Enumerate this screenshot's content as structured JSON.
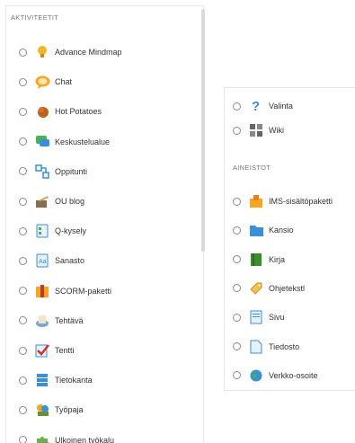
{
  "left_panel": {
    "heading": "AKTIVITEETIT",
    "items": [
      {
        "label": "Advance Mindmap",
        "icon": "lightbulb-icon"
      },
      {
        "label": "Chat",
        "icon": "chat-bubble-icon"
      },
      {
        "label": "Hot Potatoes",
        "icon": "hot-potato-icon"
      },
      {
        "label": "Keskustelualue",
        "icon": "forum-icon"
      },
      {
        "label": "Oppitunti",
        "icon": "lesson-icon"
      },
      {
        "label": "OU blog",
        "icon": "blog-icon"
      },
      {
        "label": "Q-kysely",
        "icon": "questionnaire-icon"
      },
      {
        "label": "Sanasto",
        "icon": "glossary-icon"
      },
      {
        "label": "SCORM-paketti",
        "icon": "scorm-package-icon"
      },
      {
        "label": "Tehtävä",
        "icon": "assignment-icon"
      },
      {
        "label": "Tentti",
        "icon": "quiz-checkmark-icon"
      },
      {
        "label": "Tietokanta",
        "icon": "database-icon"
      },
      {
        "label": "Työpaja",
        "icon": "workshop-icon"
      },
      {
        "label": "Ulkoinen työkalu",
        "icon": "puzzle-piece-icon"
      }
    ]
  },
  "right_panel": {
    "top_items": [
      {
        "label": "Valinta",
        "icon": "question-mark-icon"
      },
      {
        "label": "Wiki",
        "icon": "wiki-icon"
      }
    ],
    "heading": "AINEISTOT",
    "items": [
      {
        "label": "IMS-sisältöpaketti",
        "icon": "ims-package-icon"
      },
      {
        "label": "Kansio",
        "icon": "folder-icon"
      },
      {
        "label": "Kirja",
        "icon": "book-icon"
      },
      {
        "label": "Ohjetekstl",
        "icon": "label-tag-icon"
      },
      {
        "label": "Sivu",
        "icon": "page-icon"
      },
      {
        "label": "Tiedosto",
        "icon": "file-icon"
      },
      {
        "label": "Verkko-osoite",
        "icon": "url-globe-icon"
      }
    ]
  },
  "colors": {
    "text": "#333333",
    "heading": "#777777",
    "border": "#e6e6e6",
    "radio": "#8a8a8a"
  }
}
